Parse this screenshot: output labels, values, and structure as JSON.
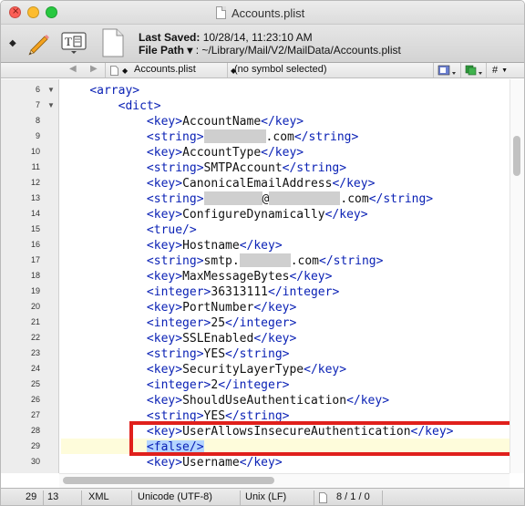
{
  "window": {
    "title": "Accounts.plist"
  },
  "toolbar": {
    "last_saved_label": "Last Saved:",
    "last_saved_value": "10/28/14, 11:23:10 AM",
    "file_path_label": "File Path",
    "file_path_arrow": "▾",
    "file_path_value": ": ~/Library/Mail/V2/MailData/Accounts.plist"
  },
  "navbar": {
    "back": "◀",
    "forward": "▶",
    "file_diamond": "◆",
    "filename": "Accounts.plist",
    "symbol_diamond": "◆",
    "symbol_menu": "(no symbol selected)",
    "hash": "#"
  },
  "editor": {
    "lines": [
      {
        "no": "6",
        "fold": "▼",
        "pre": "    ",
        "text": "<array>"
      },
      {
        "no": "7",
        "fold": "▼",
        "pre": "        ",
        "text": "<dict>"
      },
      {
        "no": "8",
        "pre": "            ",
        "tag1": "<key>",
        "val": "AccountName",
        "tag2": "</key>"
      },
      {
        "no": "9",
        "pre": "            ",
        "tag1": "<string>",
        "val": "",
        "val2": ".com",
        "tag2": "</string>"
      },
      {
        "no": "10",
        "pre": "            ",
        "tag1": "<key>",
        "val": "AccountType",
        "tag2": "</key>"
      },
      {
        "no": "11",
        "pre": "            ",
        "tag1": "<string>",
        "val": "SMTPAccount",
        "tag2": "</string>"
      },
      {
        "no": "12",
        "pre": "            ",
        "tag1": "<key>",
        "val": "CanonicalEmailAddress",
        "tag2": "</key>"
      },
      {
        "no": "13",
        "pre": "            ",
        "tag1": "<string>",
        "val": "",
        "val2": "@",
        "val3": ".com",
        "tag2": "</string>"
      },
      {
        "no": "14",
        "pre": "            ",
        "tag1": "<key>",
        "val": "ConfigureDynamically",
        "tag2": "</key>"
      },
      {
        "no": "15",
        "pre": "            ",
        "tag1": "<true/>",
        "val": "",
        "tag2": ""
      },
      {
        "no": "16",
        "pre": "            ",
        "tag1": "<key>",
        "val": "Hostname",
        "tag2": "</key>"
      },
      {
        "no": "17",
        "pre": "            ",
        "tag1": "<string>",
        "val": "smtp.",
        "val2": ".com",
        "tag2": "</string>"
      },
      {
        "no": "18",
        "pre": "            ",
        "tag1": "<key>",
        "val": "MaxMessageBytes",
        "tag2": "</key>"
      },
      {
        "no": "19",
        "pre": "            ",
        "tag1": "<integer>",
        "val": "36313111",
        "tag2": "</integer>"
      },
      {
        "no": "20",
        "pre": "            ",
        "tag1": "<key>",
        "val": "PortNumber",
        "tag2": "</key>"
      },
      {
        "no": "21",
        "pre": "            ",
        "tag1": "<integer>",
        "val": "25",
        "tag2": "</integer>"
      },
      {
        "no": "22",
        "pre": "            ",
        "tag1": "<key>",
        "val": "SSLEnabled",
        "tag2": "</key>"
      },
      {
        "no": "23",
        "pre": "            ",
        "tag1": "<string>",
        "val": "YES",
        "tag2": "</string>"
      },
      {
        "no": "24",
        "pre": "            ",
        "tag1": "<key>",
        "val": "SecurityLayerType",
        "tag2": "</key>"
      },
      {
        "no": "25",
        "pre": "            ",
        "tag1": "<integer>",
        "val": "2",
        "tag2": "</integer>"
      },
      {
        "no": "26",
        "pre": "            ",
        "tag1": "<key>",
        "val": "ShouldUseAuthentication",
        "tag2": "</key>"
      },
      {
        "no": "27",
        "pre": "            ",
        "tag1": "<string>",
        "val": "YES",
        "tag2": "</string>"
      },
      {
        "no": "28",
        "pre": "            ",
        "tag1": "<key>",
        "val": "UserAllowsInsecureAuthentication",
        "tag2": "</key>"
      },
      {
        "no": "29",
        "pre": "            ",
        "tag1": "<false/>",
        "val": "",
        "tag2": ""
      },
      {
        "no": "30",
        "pre": "            ",
        "tag1": "<key>",
        "val": "Username",
        "tag2": "</key>"
      }
    ]
  },
  "status": {
    "line": "29",
    "column": "13",
    "language": "XML",
    "encoding": "Unicode (UTF-8)",
    "line_endings": "Unix (LF)",
    "counts": "8 / 1 / 0"
  },
  "colors": {
    "tag": "#0a21b5",
    "highlight_line": "#fefcdb",
    "selection": "#b5d5ff",
    "annotation_box": "#e0201c"
  }
}
